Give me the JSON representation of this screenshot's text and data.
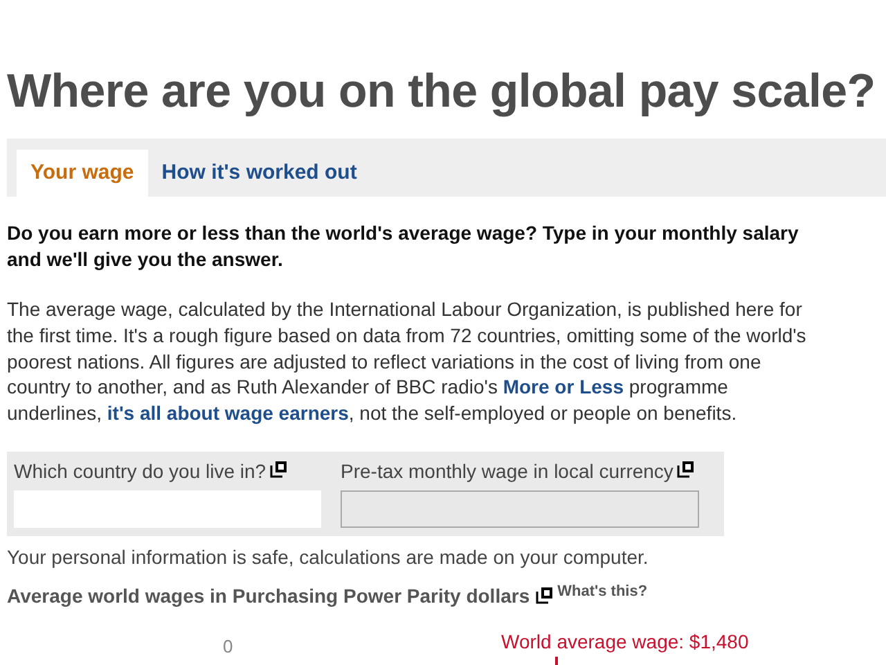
{
  "page": {
    "title": "Where are you on the global pay scale?"
  },
  "tabs": [
    {
      "label": "Your wage",
      "selected": true
    },
    {
      "label": "How it's worked out",
      "selected": false
    }
  ],
  "question": "Do you earn more or less than the world's average wage? Type in your monthly salary and we'll give you the answer.",
  "paragraph": [
    {
      "kind": "text",
      "text": "The average wage, calculated by the International Labour Organization, is published here for the first time. It's a rough figure based on data from 72 countries, omitting some of the world's poorest nations. All figures are adjusted to reflect variations in the cost of living from one country to another, and as Ruth Alexander of BBC radio's "
    },
    {
      "kind": "link",
      "text": "More or Less"
    },
    {
      "kind": "text",
      "text": " programme underlines, "
    },
    {
      "kind": "link",
      "text": "it's all about wage earners"
    },
    {
      "kind": "text",
      "text": ", not the self-employed or people on benefits."
    }
  ],
  "form": {
    "fields": [
      {
        "label": "Which country do you live in?",
        "disabled": false
      },
      {
        "label": "Pre-tax monthly wage in local currency",
        "disabled": true
      }
    ]
  },
  "privacy_note": "Your personal information is safe, calculations are made on your computer.",
  "chart_section": {
    "title": "Average world wages in Purchasing Power Parity dollars",
    "help_link": "What's this?",
    "axis_start": "0",
    "average_label": "World average wage: $1,480"
  }
}
